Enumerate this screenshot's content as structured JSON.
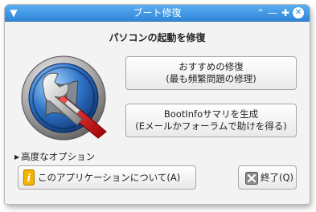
{
  "window": {
    "title": "ブート修復",
    "controls": {
      "menu_icon": "chevron-down-icon",
      "up_icon": "chevron-up-icon",
      "minimize_icon": "minimize-icon",
      "maximize_icon": "maximize-icon",
      "close_icon": "close-icon"
    },
    "title_color": "#2f86d8"
  },
  "main": {
    "heading": "パソコンの起動を修復",
    "recommended_button": {
      "line1": "おすすめの修復",
      "line2": "(最も頻繁問題の修理)"
    },
    "bootinfo_button": {
      "line1": "BootInfoサマリを生成",
      "line2": "(Eメールかフォーラムで助けを得る)"
    },
    "advanced_options": "高度なオプション"
  },
  "footer": {
    "about_button": "このアプリケーションについて(A)",
    "quit_button": "終了(Q)"
  }
}
